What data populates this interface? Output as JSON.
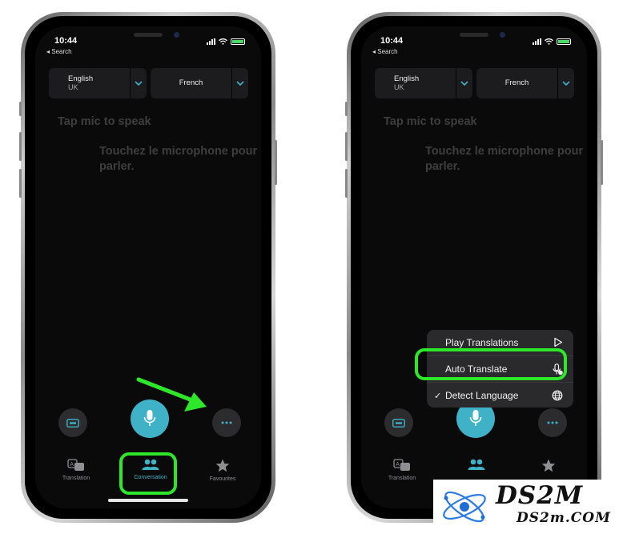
{
  "status": {
    "time": "10:44",
    "back": "◂ Search"
  },
  "languages": {
    "source": {
      "name": "English",
      "region": "UK"
    },
    "target": {
      "name": "French"
    }
  },
  "prompts": {
    "source": "Tap mic to speak",
    "target": "Touchez le microphone pour parler."
  },
  "tabs": [
    {
      "label": "Translation",
      "icon": "translate-icon"
    },
    {
      "label": "Conversation",
      "icon": "people-icon"
    },
    {
      "label": "Favourites",
      "icon": "star-icon"
    }
  ],
  "menu": {
    "items": [
      {
        "label": "Play Translations",
        "icon": "play-icon",
        "checked": false
      },
      {
        "label": "Auto Translate",
        "icon": "mic-auto-icon",
        "checked": false
      },
      {
        "label": "Detect Language",
        "icon": "globe-icon",
        "checked": true,
        "check": "✓"
      }
    ]
  },
  "colors": {
    "accent": "#3fb2c8",
    "highlight": "#2ee62a",
    "screen": "#0a0a0a"
  },
  "watermark": {
    "brand": "DS2M",
    "domain": "DS2m.COM"
  }
}
